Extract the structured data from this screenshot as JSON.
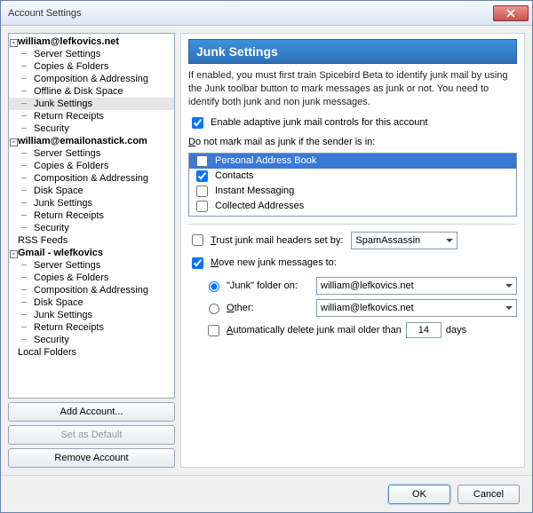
{
  "window": {
    "title": "Account Settings"
  },
  "tree": {
    "accounts": [
      {
        "name": "william@lefkovics.net",
        "expanded": true,
        "items": [
          "Server Settings",
          "Copies & Folders",
          "Composition & Addressing",
          "Offline & Disk Space",
          "Junk Settings",
          "Return Receipts",
          "Security"
        ],
        "selectedIndex": 4
      },
      {
        "name": "william@emailonastick.com",
        "expanded": true,
        "items": [
          "Server Settings",
          "Copies & Folders",
          "Composition & Addressing",
          "Disk Space",
          "Junk Settings",
          "Return Receipts",
          "Security"
        ]
      },
      {
        "name": "RSS Feeds",
        "leaf": true
      },
      {
        "name": "Gmail - wlefkovics",
        "expanded": true,
        "items": [
          "Server Settings",
          "Copies & Folders",
          "Composition & Addressing",
          "Disk Space",
          "Junk Settings",
          "Return Receipts",
          "Security"
        ]
      },
      {
        "name": "Local Folders",
        "leaf": true
      }
    ]
  },
  "sidebar_buttons": {
    "add": "Add Account...",
    "default": "Set as Default",
    "remove": "Remove Account"
  },
  "panel": {
    "title": "Junk Settings",
    "description": "If enabled, you must first train Spicebird Beta to identify junk mail by using the Junk toolbar button to mark messages as junk or not. You need to identify both junk and non junk messages.",
    "enable_label": "Enable adaptive junk mail controls for this account",
    "enable_checked": true,
    "sender_label_pre": "D",
    "sender_label_rest": "o not mark mail as junk if the sender is in:",
    "sender_list": [
      {
        "label": "Personal Address Book",
        "checked": false,
        "selected": true
      },
      {
        "label": "Contacts",
        "checked": true,
        "selected": false
      },
      {
        "label": "Instant Messaging",
        "checked": false,
        "selected": false
      },
      {
        "label": "Collected Addresses",
        "checked": false,
        "selected": false
      }
    ],
    "trust_label_pre": "T",
    "trust_label_rest": "rust junk mail headers set by:",
    "trust_checked": false,
    "trust_options": [
      "SpamAssassin"
    ],
    "trust_value": "SpamAssassin",
    "move_label_pre": "M",
    "move_label_rest": "ove new junk messages to:",
    "move_checked": true,
    "junk_dest_label": "\"Junk\" folder on:",
    "junk_dest_value": "william@lefkovics.net",
    "other_label_pre": "O",
    "other_label_rest": "ther:",
    "other_value": "william@lefkovics.net",
    "dest_choice": "junk",
    "auto_delete_pre": "A",
    "auto_delete_rest": "utomatically delete junk mail older than",
    "auto_delete_checked": false,
    "auto_delete_days": "14",
    "days_label": "days"
  },
  "footer": {
    "ok": "OK",
    "cancel": "Cancel"
  }
}
